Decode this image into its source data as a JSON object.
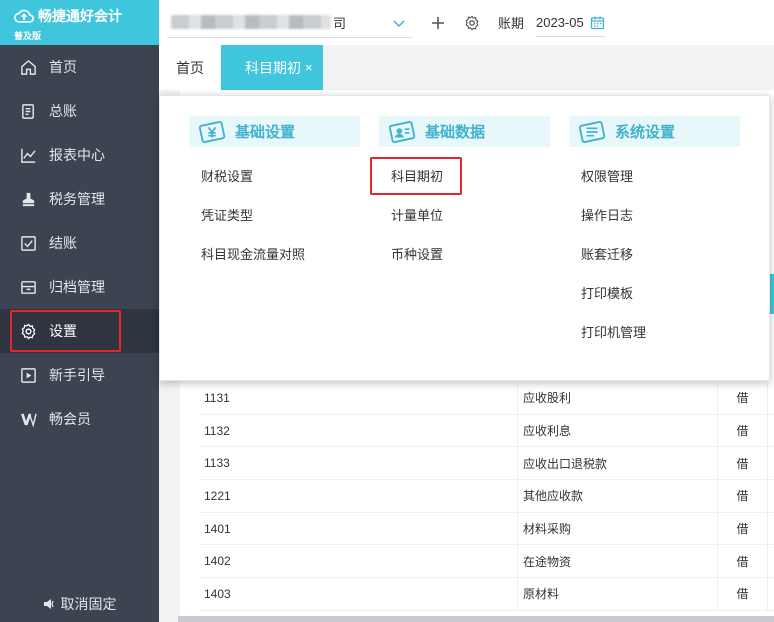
{
  "brand": {
    "name": "畅捷通好会计",
    "edition": "普及版"
  },
  "nav": [
    {
      "label": "首页",
      "icon": "home-icon"
    },
    {
      "label": "总账",
      "icon": "ledger-icon"
    },
    {
      "label": "报表中心",
      "icon": "chart-icon"
    },
    {
      "label": "税务管理",
      "icon": "stamp-icon"
    },
    {
      "label": "结账",
      "icon": "checkout-icon"
    },
    {
      "label": "归档管理",
      "icon": "archive-icon"
    },
    {
      "label": "设置",
      "icon": "gear-icon"
    },
    {
      "label": "新手引导",
      "icon": "video-icon"
    },
    {
      "label": "畅会员",
      "icon": "vip-icon"
    }
  ],
  "unpin_label": "取消固定",
  "topbar": {
    "company_suffix": "司",
    "period_label": "账期",
    "period_value": "2023-05"
  },
  "tabs": {
    "home": "首页",
    "active": "科目期初",
    "close": "×"
  },
  "menu": {
    "groups": [
      {
        "title": "基础设置",
        "items": [
          "财税设置",
          "凭证类型",
          "科目现金流量对照"
        ]
      },
      {
        "title": "基础数据",
        "items": [
          "科目期初",
          "计量单位",
          "币种设置"
        ]
      },
      {
        "title": "系统设置",
        "items": [
          "权限管理",
          "操作日志",
          "账套迁移",
          "打印模板",
          "打印机管理"
        ]
      }
    ]
  },
  "table": {
    "rows": [
      {
        "code": "1131",
        "name": "应收股利",
        "dir": "借"
      },
      {
        "code": "1132",
        "name": "应收利息",
        "dir": "借"
      },
      {
        "code": "1133",
        "name": "应收出口退税款",
        "dir": "借"
      },
      {
        "code": "1221",
        "name": "其他应收款",
        "dir": "借"
      },
      {
        "code": "1401",
        "name": "材料采购",
        "dir": "借"
      },
      {
        "code": "1402",
        "name": "在途物资",
        "dir": "借"
      },
      {
        "code": "1403",
        "name": "原材料",
        "dir": "借"
      }
    ]
  },
  "colors": {
    "accent": "#3fc6dc",
    "sidebar": "#3d4451",
    "highlight": "#e8242c"
  }
}
